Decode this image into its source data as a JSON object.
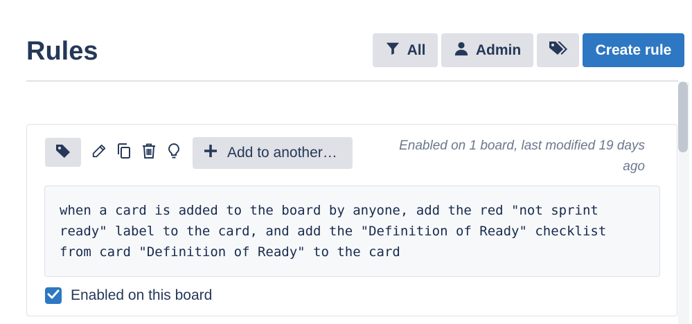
{
  "header": {
    "title": "Rules",
    "filter_all_label": "All",
    "filter_admin_label": "Admin",
    "create_rule_label": "Create rule"
  },
  "rule": {
    "add_to_another_label": "Add to another…",
    "meta": "Enabled on 1 board, last modified 19 days ago",
    "description": "when a card is added to the board by anyone, add the red \"not sprint ready\" label to the card, and add the \"Definition of Ready\" checklist from card \"Definition of Ready\" to the card",
    "enabled_label": "Enabled on this board",
    "enabled": true
  },
  "icons": {
    "filter": "filter-icon",
    "user": "user-icon",
    "tags": "tags-icon",
    "tag": "tag-icon",
    "edit": "pencil-icon",
    "copy": "copy-icon",
    "delete": "trash-icon",
    "idea": "lightbulb-icon",
    "add": "plus-icon",
    "check": "check-icon"
  },
  "colors": {
    "primary": "#2d77c3",
    "button_bg": "#dfe1e6",
    "text_dark": "#253858",
    "text_muted": "#6b778c"
  }
}
